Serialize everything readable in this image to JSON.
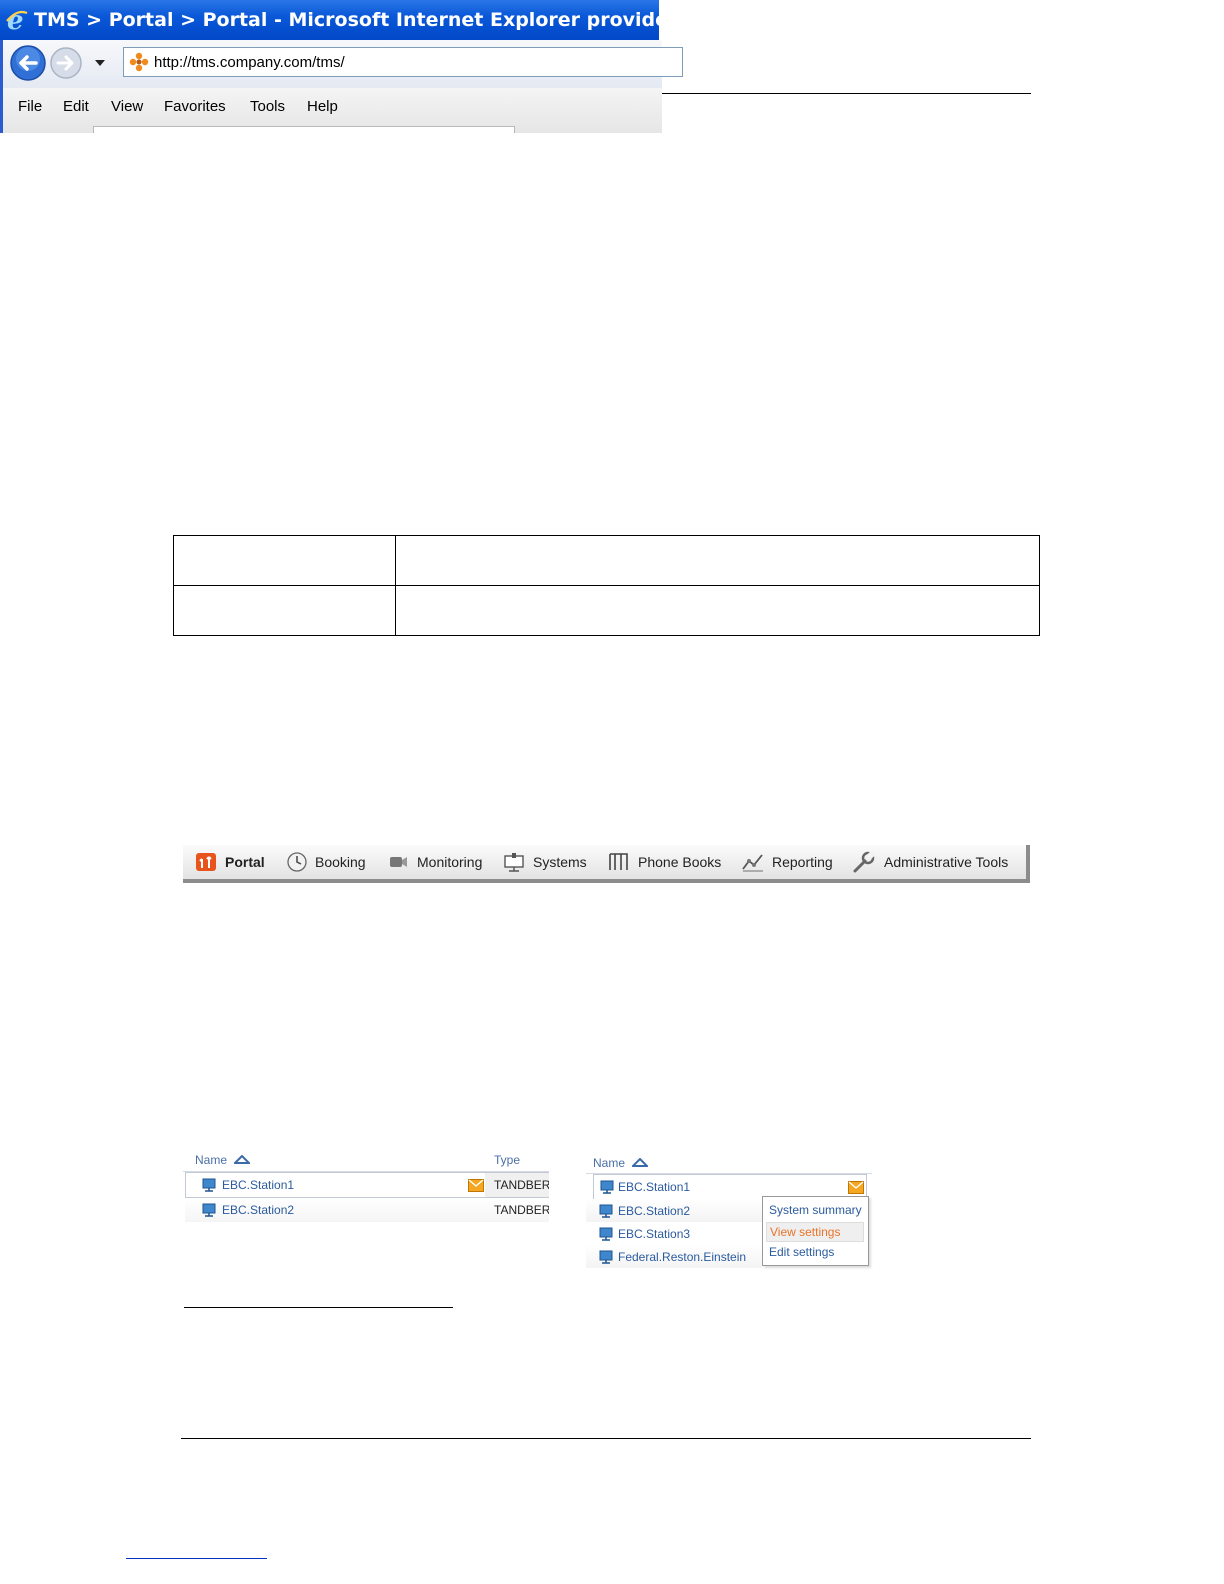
{
  "browser": {
    "title": "TMS > Portal > Portal - Microsoft Internet Explorer provided by TANDBERG",
    "address_url": "http://tms.company.com/tms/",
    "menu": [
      "File",
      "Edit",
      "View",
      "Favorites",
      "Tools",
      "Help"
    ]
  },
  "tms_menu": [
    "Portal",
    "Booking",
    "Monitoring",
    "Systems",
    "Phone Books",
    "Reporting",
    "Administrative Tools"
  ],
  "list_left": {
    "headers": {
      "name": "Name",
      "type": "Type"
    },
    "rows": [
      {
        "name": "EBC.Station1",
        "type": "TANDBERG"
      },
      {
        "name": "EBC.Station2",
        "type": "TANDBERG"
      }
    ]
  },
  "list_right": {
    "header": "Name",
    "rows": [
      "EBC.Station1",
      "EBC.Station2",
      "EBC.Station3",
      "Federal.Reston.Einstein"
    ],
    "context_menu": [
      "System summary",
      "View settings",
      "Edit settings"
    ]
  },
  "colors": {
    "xp_title_blue": "#0a58d8",
    "link_blue": "#2b5b9e",
    "highlight_orange": "#e8742a"
  }
}
